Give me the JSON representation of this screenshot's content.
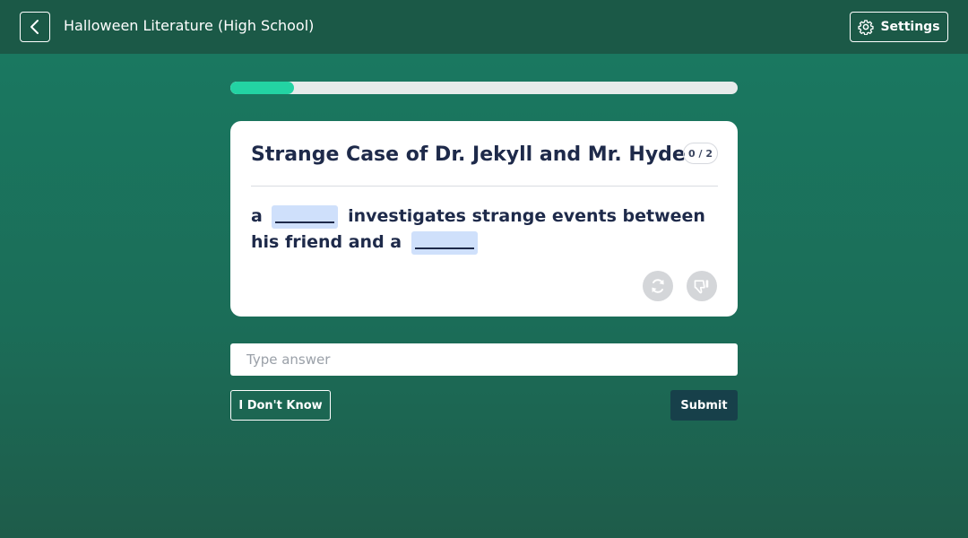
{
  "header": {
    "title": "Halloween Literature (High School)",
    "settings_label": "Settings",
    "back_icon": "chevron-left-icon",
    "settings_icon": "gear-icon"
  },
  "progress": {
    "fraction": 0.125
  },
  "card": {
    "title": "Strange Case of Dr. Jekyll and Mr. Hyde",
    "score": "0 / 2",
    "prompt_parts": [
      "a",
      "investigates strange events between his friend and a"
    ],
    "blank_count": 2,
    "icons": [
      "refresh-icon",
      "thumbs-down-icon"
    ]
  },
  "answer": {
    "placeholder": "Type answer",
    "value": ""
  },
  "actions": {
    "dont_know_label": "I Don't Know",
    "submit_label": "Submit"
  },
  "colors": {
    "progress_fill": "#23d3a3",
    "blank_highlight": "#cfe0fb",
    "submit_bg": "#17404a",
    "text_dark": "#1e2a4a"
  }
}
